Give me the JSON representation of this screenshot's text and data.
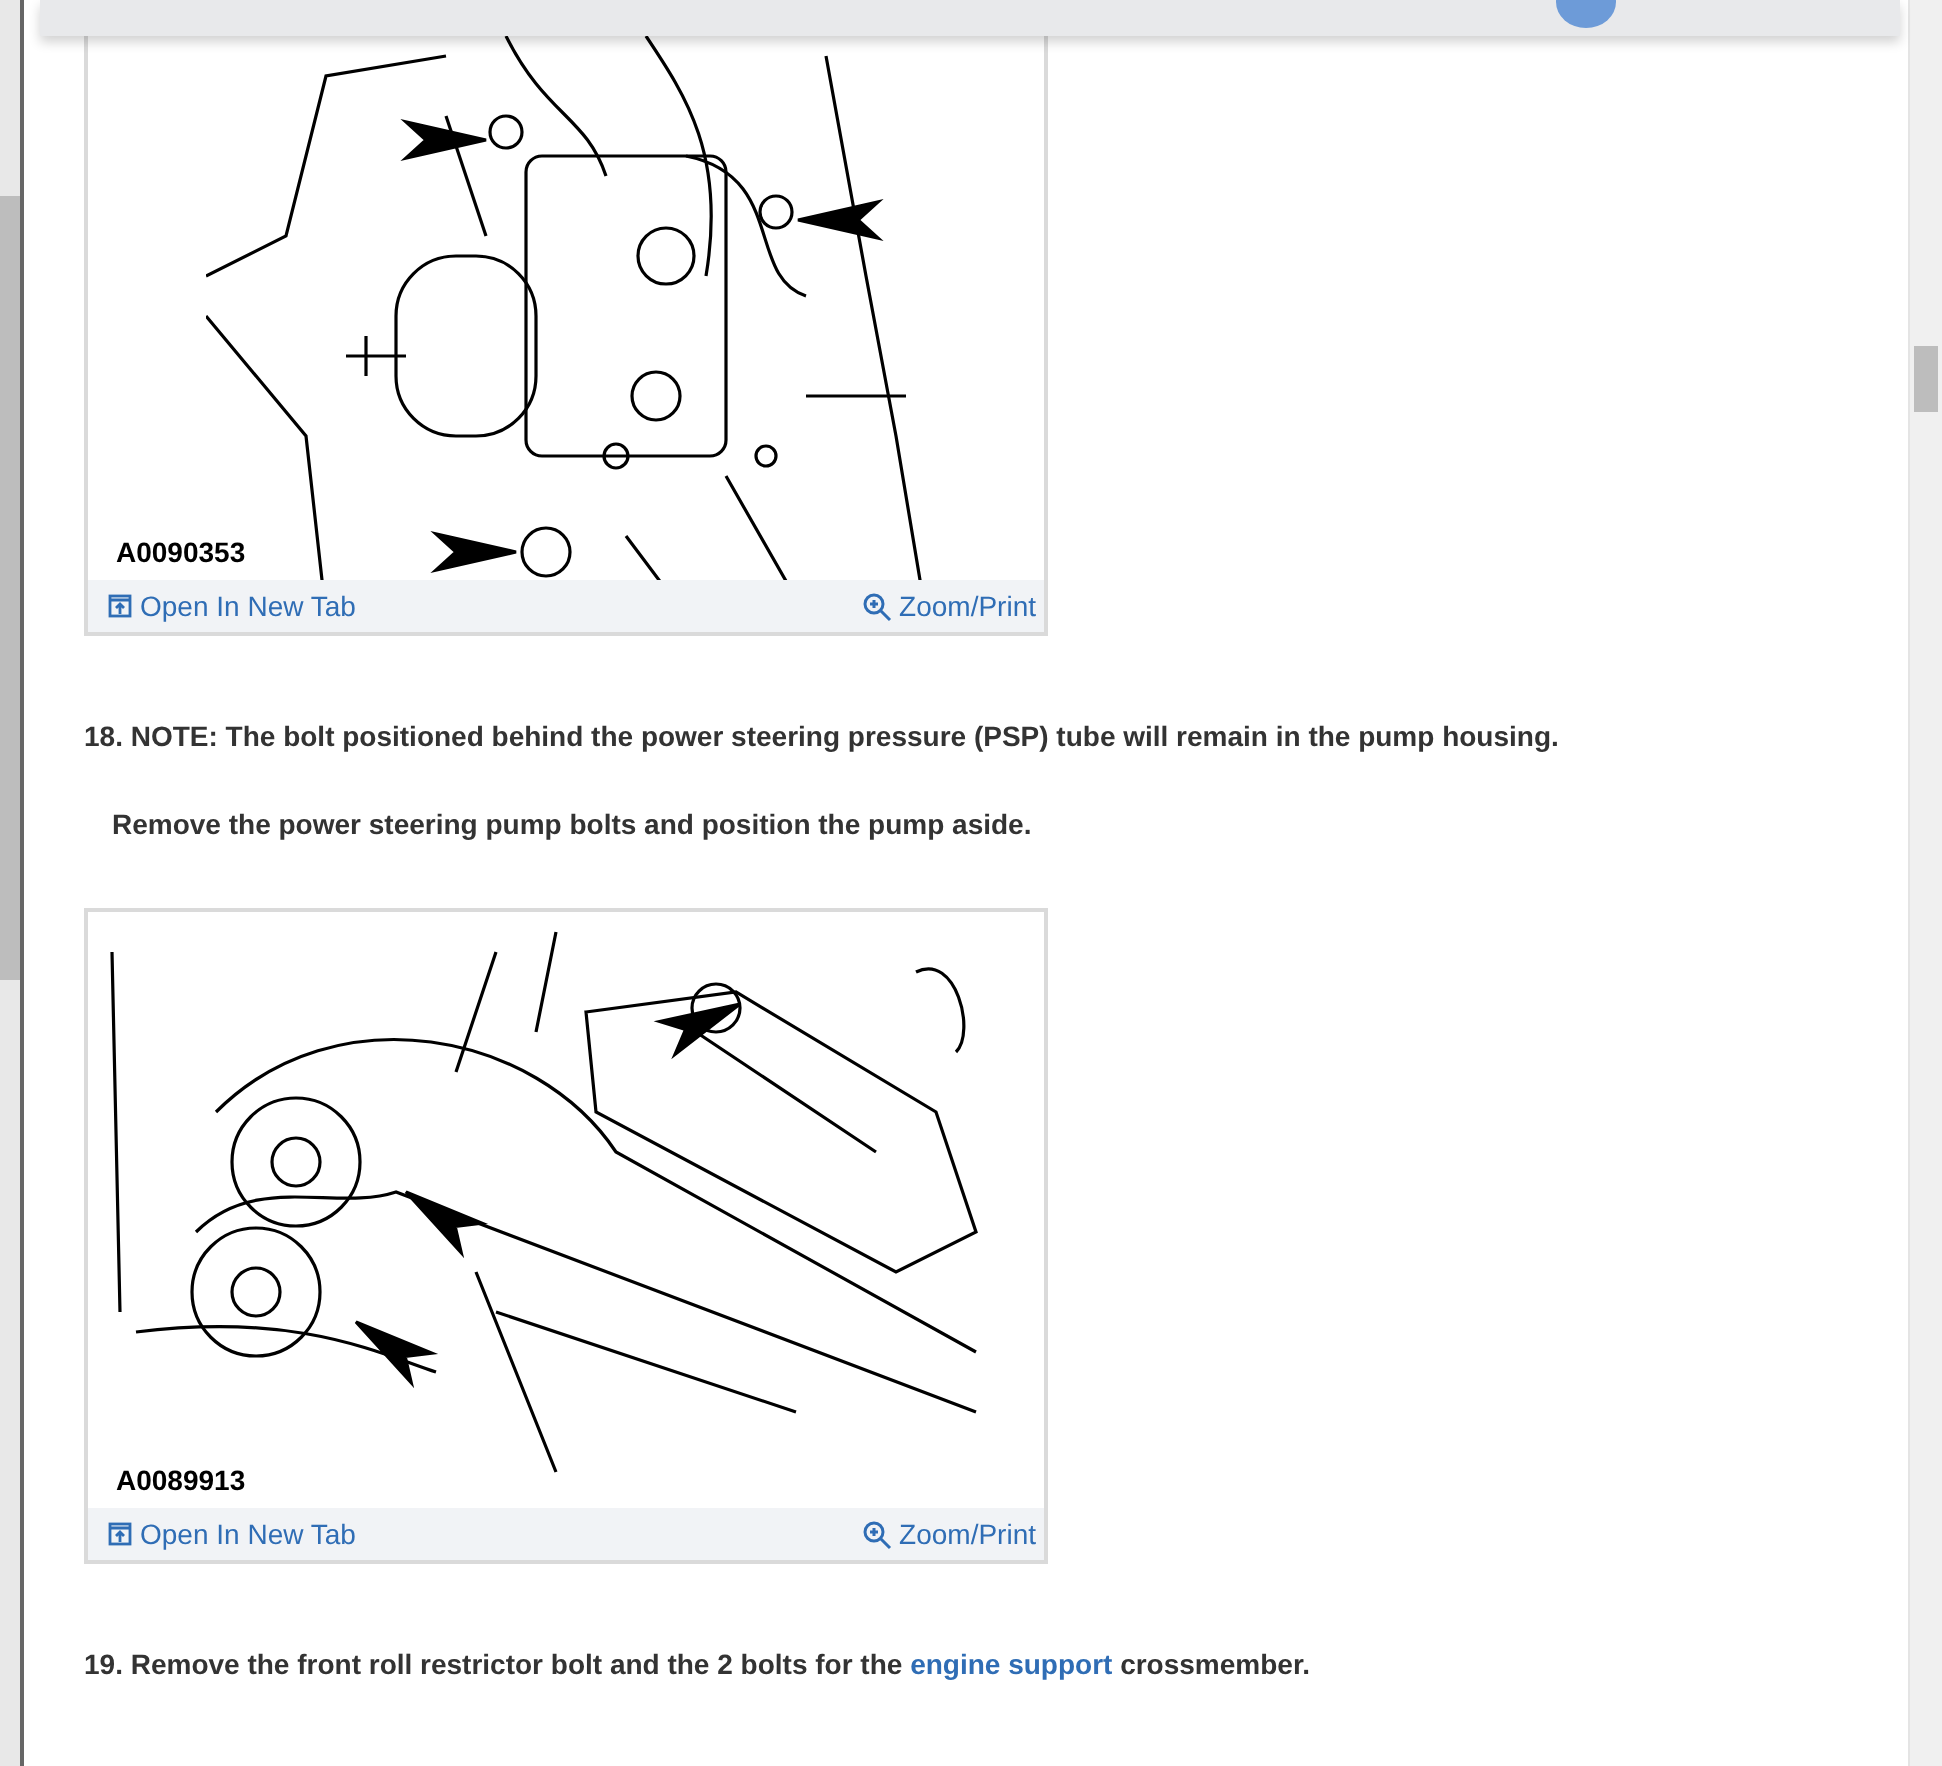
{
  "steps": [
    {
      "kind": "figure",
      "figure": {
        "kind": "pump",
        "code": "A0090353",
        "open_link": "Open In New Tab",
        "zoom_link": "Zoom/Print"
      }
    },
    {
      "kind": "plain",
      "text": "18. NOTE: The bolt positioned behind the power steering pressure (PSP) tube will remain in the pump housing."
    },
    {
      "kind": "indented",
      "text": "Remove the power steering pump bolts and position the pump aside."
    },
    {
      "kind": "figure",
      "figure": {
        "kind": "mount",
        "code": "A0089913",
        "open_link": "Open In New Tab",
        "zoom_link": "Zoom/Print"
      }
    },
    {
      "kind": "linked",
      "before": "19. Remove the front roll restrictor bolt and the 2 bolts for the ",
      "link": "engine support",
      "after": " crossmember."
    }
  ]
}
